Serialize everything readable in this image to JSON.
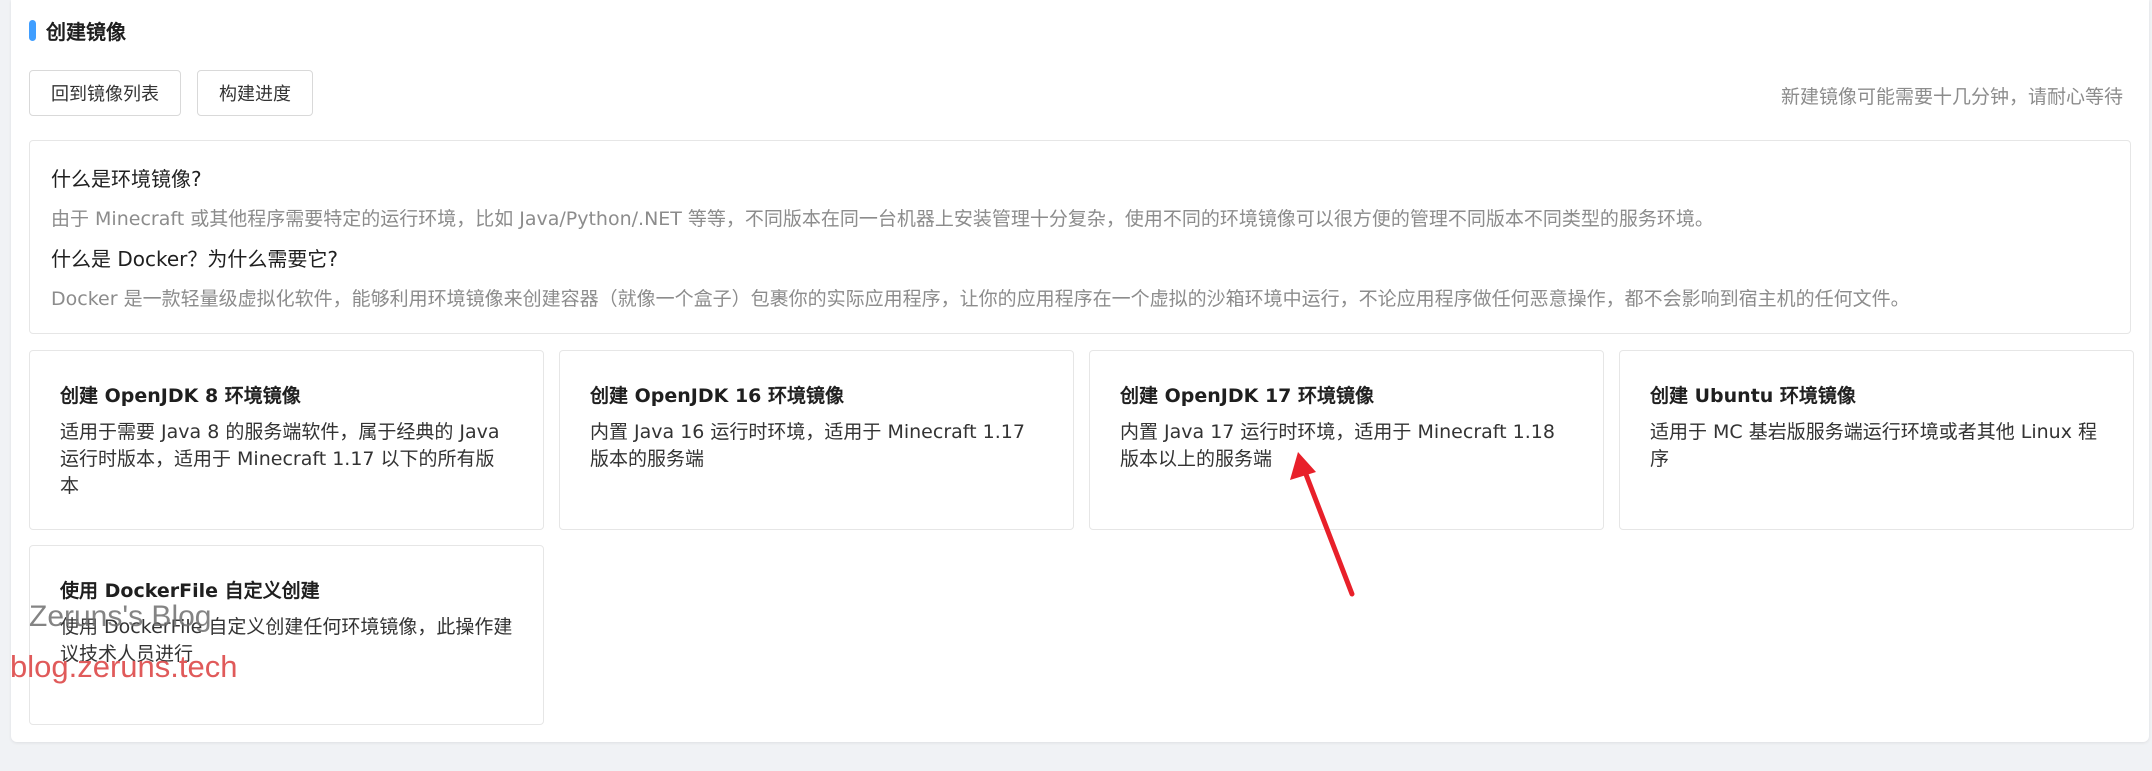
{
  "page": {
    "title": "创建镜像",
    "accent_color": "#409eff"
  },
  "toolbar": {
    "back_label": "回到镜像列表",
    "progress_label": "构建进度",
    "hint": "新建镜像可能需要十几分钟，请耐心等待"
  },
  "info": {
    "q1": "什么是环境镜像?",
    "a1": "由于 Minecraft 或其他程序需要特定的运行环境，比如 Java/Python/.NET 等等，不同版本在同一台机器上安装管理十分复杂，使用不同的环境镜像可以很方便的管理不同版本不同类型的服务环境。",
    "q2": "什么是 Docker？为什么需要它?",
    "a2": "Docker 是一款轻量级虚拟化软件，能够利用环境镜像来创建容器（就像一个盒子）包裹你的实际应用程序，让你的应用程序在一个虚拟的沙箱环境中运行，不论应用程序做任何恶意操作，都不会影响到宿主机的任何文件。"
  },
  "cards": [
    {
      "title": "创建 OpenJDK 8 环境镜像",
      "desc": "适用于需要 Java 8 的服务端软件，属于经典的 Java 运行时版本，适用于 Minecraft 1.17 以下的所有版本"
    },
    {
      "title": "创建 OpenJDK 16 环境镜像",
      "desc": "内置 Java 16 运行时环境，适用于 Minecraft 1.17 版本的服务端"
    },
    {
      "title": "创建 OpenJDK 17 环境镜像",
      "desc": "内置 Java 17 运行时环境，适用于 Minecraft 1.18 版本以上的服务端"
    },
    {
      "title": "创建 Ubuntu 环境镜像",
      "desc": "适用于 MC 基岩版服务端运行环境或者其他 Linux 程序"
    },
    {
      "title": "使用 DockerFile 自定义创建",
      "desc": "使用 DockerFile 自定义创建任何环境镜像，此操作建议技术人员进行"
    }
  ],
  "watermark": {
    "line1": "Zeruns's Blog",
    "line2": "blog.zeruns.tech"
  },
  "annotation": {
    "arrow_color": "#e8202a"
  }
}
